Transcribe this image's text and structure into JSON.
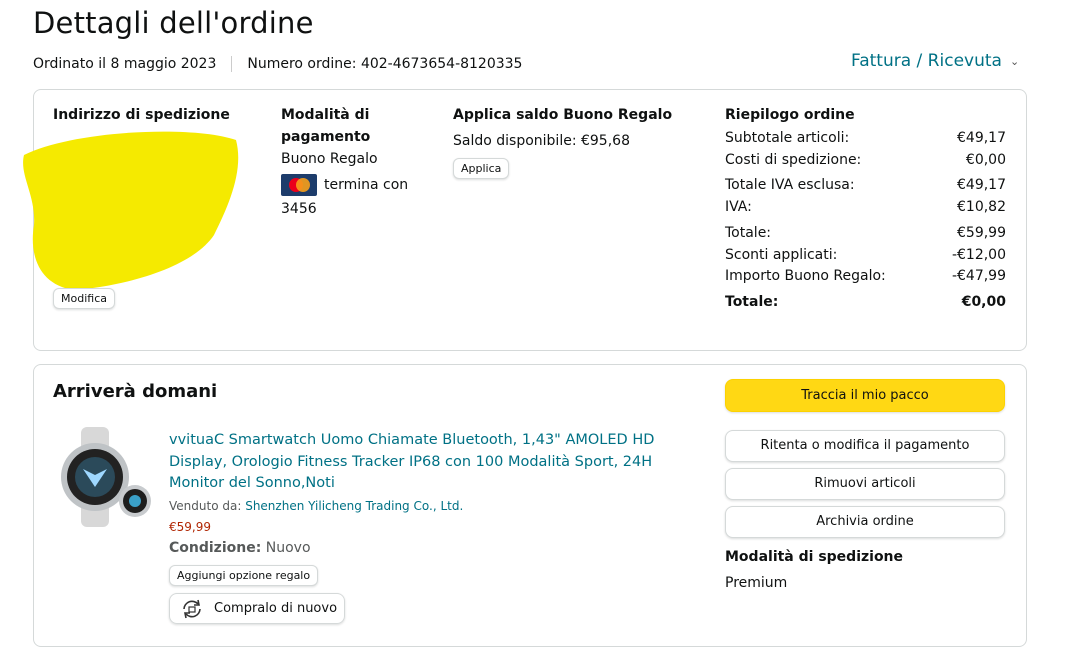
{
  "page": {
    "title": "Dettagli dell'ordine",
    "order_date": "Ordinato il 8 maggio 2023",
    "order_number": "Numero ordine: 402-4673654-8120335",
    "invoice_label": "Fattura / Ricevuta"
  },
  "shipping_address": {
    "heading": "Indirizzo di spedizione",
    "edit_label": "Modifica"
  },
  "payment": {
    "heading_line1": "Modalità di",
    "heading_line2": "pagamento",
    "method": "Buono Regalo",
    "card_text": "termina con",
    "card_last": "3456"
  },
  "gift_balance": {
    "heading": "Applica saldo Buono Regalo",
    "available": "Saldo disponibile: €95,68",
    "apply_label": "Applica"
  },
  "summary": {
    "heading": "Riepilogo ordine",
    "rows": [
      {
        "label": "Subtotale articoli:",
        "value": "€49,17"
      },
      {
        "label": "Costi di spedizione:",
        "value": "€0,00"
      },
      {
        "label": "Totale IVA esclusa:",
        "value": "€49,17"
      },
      {
        "label": "IVA:",
        "value": "€10,82"
      },
      {
        "label": "Totale:",
        "value": "€59,99"
      },
      {
        "label": "Sconti applicati:",
        "value": "-€12,00"
      },
      {
        "label": "Importo Buono Regalo:",
        "value": "-€47,99"
      },
      {
        "label": "Totale:",
        "value": "€0,00"
      }
    ]
  },
  "shipment": {
    "heading": "Arriverà domani",
    "product_title": "vvituaC Smartwatch Uomo Chiamate Bluetooth, 1,43\" AMOLED HD Display, Orologio Fitness Tracker IP68 con 100 Modalità Sport, 24H Monitor del Sonno,Noti",
    "sold_by_label": "Venduto da:",
    "seller": "Shenzhen Yilicheng Trading Co., Ltd.",
    "price": "€59,99",
    "condition_label": "Condizione:",
    "condition_value": "Nuovo",
    "gift_option_label": "Aggiungi opzione regalo",
    "buy_again_label": "Compralo di nuovo"
  },
  "actions": {
    "track": "Traccia il mio pacco",
    "retry_payment": "Ritenta o modifica il pagamento",
    "remove_items": "Rimuovi articoli",
    "archive": "Archivia ordine"
  },
  "shipping_mode": {
    "heading": "Modalità di spedizione",
    "value": "Premium"
  },
  "colors": {
    "link": "#007185",
    "button_yellow": "#ffd814",
    "price": "#b12704",
    "redaction": "#f5ea00"
  },
  "icons": {
    "card": "mastercard-icon",
    "dropdown": "chevron-down-icon",
    "buy_again": "rebuy-icon"
  }
}
